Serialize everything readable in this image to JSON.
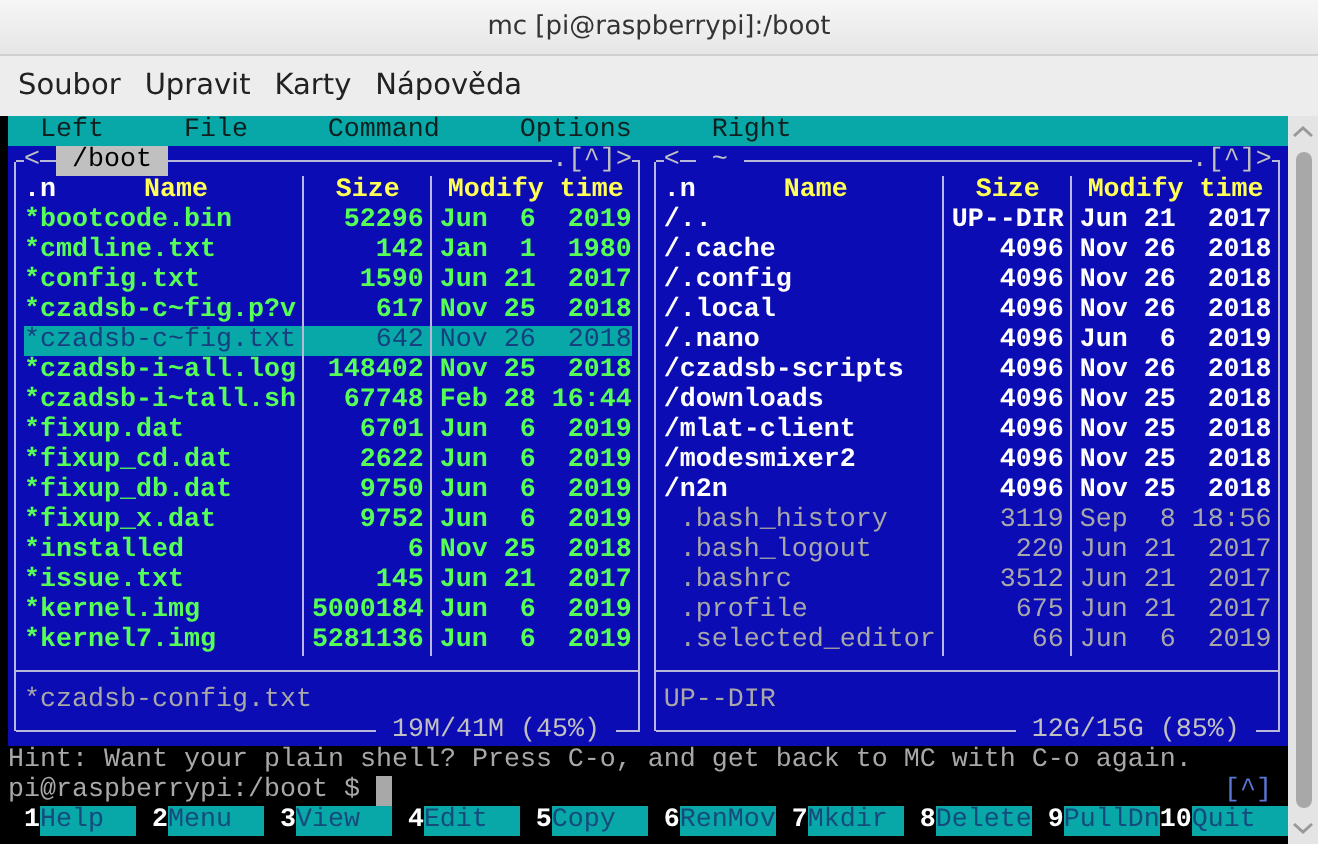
{
  "window": {
    "title": "mc [pi@raspberrypi]:/boot"
  },
  "app_menu": [
    "Soubor",
    "Upravit",
    "Karty",
    "Nápověda"
  ],
  "mc_menu": [
    "Left",
    "File",
    "Command",
    "Options",
    "Right"
  ],
  "panels": [
    {
      "active": true,
      "back": "<",
      "path": "/boot",
      "hidden_toggle": ".",
      "history": "[^]",
      "forward": ">",
      "sort": ".n",
      "columns": [
        "Name",
        "Size",
        "Modify time"
      ],
      "files": [
        {
          "name": "*bootcode.bin",
          "size": "52296",
          "modified": "Jun  6  2019",
          "kind": "executable",
          "selected": false
        },
        {
          "name": "*cmdline.txt",
          "size": "142",
          "modified": "Jan  1  1980",
          "kind": "executable",
          "selected": false
        },
        {
          "name": "*config.txt",
          "size": "1590",
          "modified": "Jun 21  2017",
          "kind": "executable",
          "selected": false
        },
        {
          "name": "*czadsb-c~fig.p?v",
          "size": "617",
          "modified": "Nov 25  2018",
          "kind": "executable",
          "selected": false
        },
        {
          "name": "*czadsb-c~fig.txt",
          "size": "642",
          "modified": "Nov 26  2018",
          "kind": "executable",
          "selected": true
        },
        {
          "name": "*czadsb-i~all.log",
          "size": "148402",
          "modified": "Nov 25  2018",
          "kind": "executable",
          "selected": false
        },
        {
          "name": "*czadsb-i~tall.sh",
          "size": "67748",
          "modified": "Feb 28 16:44",
          "kind": "executable",
          "selected": false
        },
        {
          "name": "*fixup.dat",
          "size": "6701",
          "modified": "Jun  6  2019",
          "kind": "executable",
          "selected": false
        },
        {
          "name": "*fixup_cd.dat",
          "size": "2622",
          "modified": "Jun  6  2019",
          "kind": "executable",
          "selected": false
        },
        {
          "name": "*fixup_db.dat",
          "size": "9750",
          "modified": "Jun  6  2019",
          "kind": "executable",
          "selected": false
        },
        {
          "name": "*fixup_x.dat",
          "size": "9752",
          "modified": "Jun  6  2019",
          "kind": "executable",
          "selected": false
        },
        {
          "name": "*installed",
          "size": "6",
          "modified": "Nov 25  2018",
          "kind": "executable",
          "selected": false
        },
        {
          "name": "*issue.txt",
          "size": "145",
          "modified": "Jun 21  2017",
          "kind": "executable",
          "selected": false
        },
        {
          "name": "*kernel.img",
          "size": "5000184",
          "modified": "Jun  6  2019",
          "kind": "executable",
          "selected": false
        },
        {
          "name": "*kernel7.img",
          "size": "5281136",
          "modified": "Jun  6  2019",
          "kind": "executable",
          "selected": false
        }
      ],
      "mini_status": "*czadsb-config.txt",
      "disk_usage": "19M/41M (45%)"
    },
    {
      "active": false,
      "back": "<",
      "path": "~",
      "hidden_toggle": ".",
      "history": "[^]",
      "forward": ">",
      "sort": ".n",
      "columns": [
        "Name",
        "Size",
        "Modify time"
      ],
      "files": [
        {
          "name": "/..",
          "size": "UP--DIR",
          "modified": "Jun 21  2017",
          "kind": "directory",
          "selected": false
        },
        {
          "name": "/.cache",
          "size": "4096",
          "modified": "Nov 26  2018",
          "kind": "directory",
          "selected": false
        },
        {
          "name": "/.config",
          "size": "4096",
          "modified": "Nov 26  2018",
          "kind": "directory",
          "selected": false
        },
        {
          "name": "/.local",
          "size": "4096",
          "modified": "Nov 26  2018",
          "kind": "directory",
          "selected": false
        },
        {
          "name": "/.nano",
          "size": "4096",
          "modified": "Jun  6  2019",
          "kind": "directory",
          "selected": false
        },
        {
          "name": "/czadsb-scripts",
          "size": "4096",
          "modified": "Nov 26  2018",
          "kind": "directory",
          "selected": false
        },
        {
          "name": "/downloads",
          "size": "4096",
          "modified": "Nov 25  2018",
          "kind": "directory",
          "selected": false
        },
        {
          "name": "/mlat-client",
          "size": "4096",
          "modified": "Nov 25  2018",
          "kind": "directory",
          "selected": false
        },
        {
          "name": "/modesmixer2",
          "size": "4096",
          "modified": "Nov 25  2018",
          "kind": "directory",
          "selected": false
        },
        {
          "name": "/n2n",
          "size": "4096",
          "modified": "Nov 25  2018",
          "kind": "directory",
          "selected": false
        },
        {
          "name": " .bash_history",
          "size": "3119",
          "modified": "Sep  8 18:56",
          "kind": "file",
          "selected": false
        },
        {
          "name": " .bash_logout",
          "size": "220",
          "modified": "Jun 21  2017",
          "kind": "file",
          "selected": false
        },
        {
          "name": " .bashrc",
          "size": "3512",
          "modified": "Jun 21  2017",
          "kind": "file",
          "selected": false
        },
        {
          "name": " .profile",
          "size": "675",
          "modified": "Jun 21  2017",
          "kind": "file",
          "selected": false
        },
        {
          "name": " .selected_editor",
          "size": "66",
          "modified": "Jun  6  2019",
          "kind": "file",
          "selected": false
        }
      ],
      "mini_status": "UP--DIR",
      "disk_usage": "12G/15G (85%)"
    }
  ],
  "hint": "Hint: Want your plain shell? Press C-o, and get back to MC with C-o again.",
  "prompt": "pi@raspberrypi:/boot $",
  "history_button": "[^]",
  "keybar": [
    {
      "number": "1",
      "label": "Help"
    },
    {
      "number": "2",
      "label": "Menu"
    },
    {
      "number": "3",
      "label": "View"
    },
    {
      "number": "4",
      "label": "Edit"
    },
    {
      "number": "5",
      "label": "Copy"
    },
    {
      "number": "6",
      "label": "RenMov"
    },
    {
      "number": "7",
      "label": "Mkdir"
    },
    {
      "number": "8",
      "label": "Delete"
    },
    {
      "number": "9",
      "label": "PullDn"
    },
    {
      "number": "10",
      "label": "Quit"
    }
  ]
}
